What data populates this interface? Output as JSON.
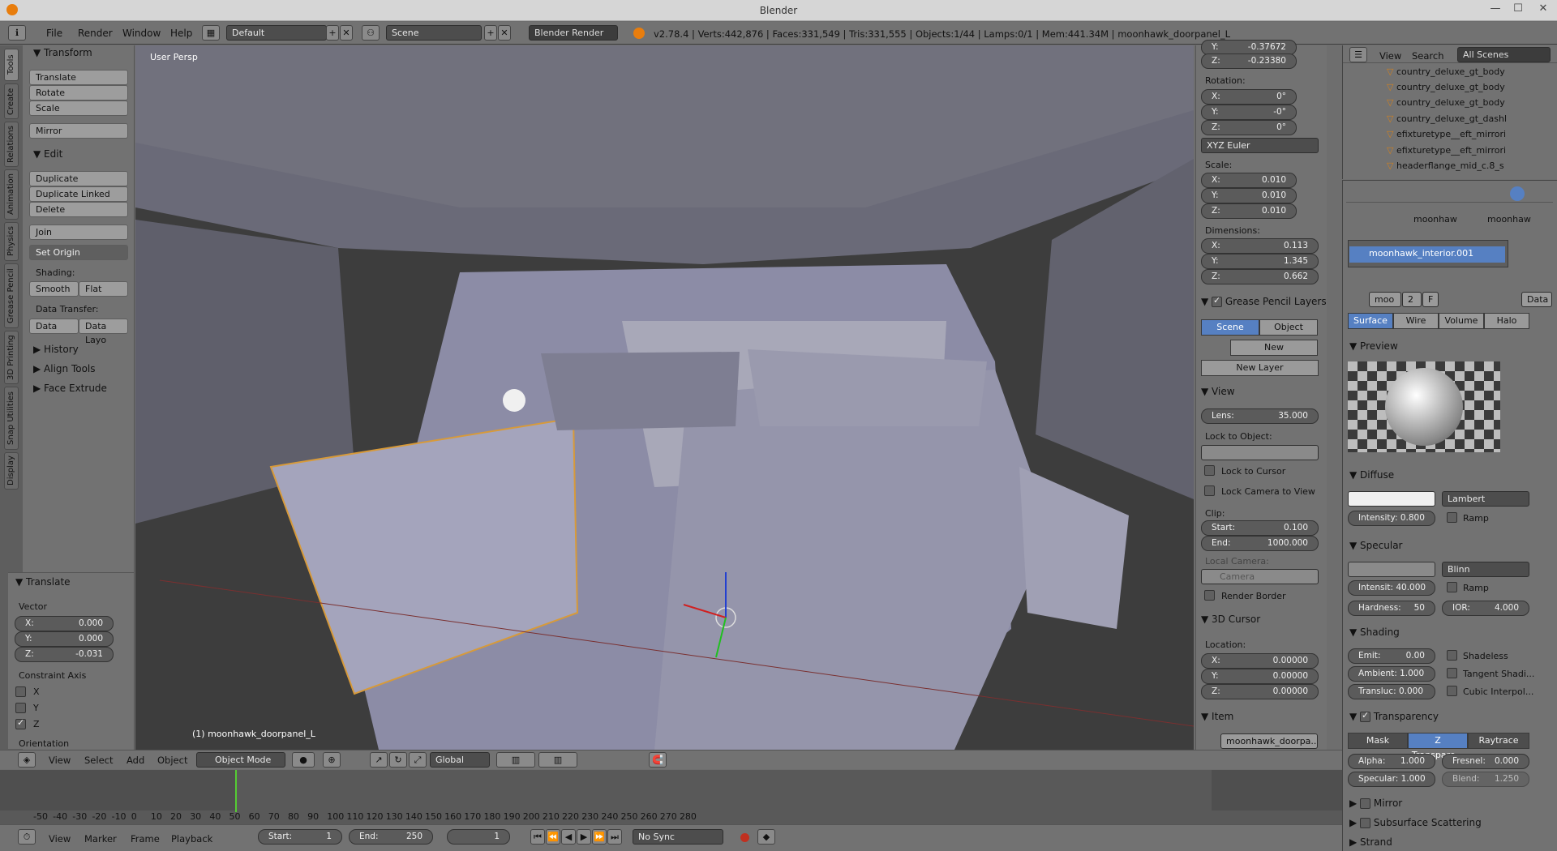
{
  "window": {
    "title": "Blender"
  },
  "topbar": {
    "menus": [
      "File",
      "Render",
      "Window",
      "Help"
    ],
    "screen_layout": "Default",
    "scene": "Scene",
    "render_engine": "Blender Render",
    "status": "v2.78.4 | Verts:442,876 | Faces:331,549 | Tris:331,555 | Objects:1/44 | Lamps:0/1 | Mem:441.34M | moonhawk_doorpanel_L"
  },
  "tool_tabs": [
    "Tools",
    "Create",
    "Relations",
    "Animation",
    "Physics",
    "Grease Pencil",
    "3D Printing",
    "Snap Utilities",
    "Display"
  ],
  "toolshelf": {
    "transform_header": "Transform",
    "transform_buttons": [
      "Translate",
      "Rotate",
      "Scale"
    ],
    "mirror": "Mirror",
    "edit_header": "Edit",
    "edit_buttons": [
      "Duplicate",
      "Duplicate Linked",
      "Delete"
    ],
    "join": "Join",
    "set_origin": "Set Origin",
    "shading_label": "Shading:",
    "smooth": "Smooth",
    "flat": "Flat",
    "data_transfer_label": "Data Transfer:",
    "data": "Data",
    "data_layo": "Data Layo",
    "collapsed": [
      "History",
      "Align Tools",
      "Face Extrude"
    ]
  },
  "operator": {
    "header": "Translate",
    "vector_label": "Vector",
    "x": "0.000",
    "y": "0.000",
    "z": "-0.031",
    "constraint_label": "Constraint Axis",
    "axes": [
      "X",
      "Y",
      "Z"
    ],
    "z_checked": true,
    "orientation": "Orientation"
  },
  "viewport": {
    "view_label": "User Persp",
    "object_label": "(1) moonhawk_doorpanel_L"
  },
  "npanel": {
    "loc_y": "-0.37672",
    "loc_z": "-0.23380",
    "rotation_label": "Rotation:",
    "rot_x": "0°",
    "rot_y": "-0°",
    "rot_z": "0°",
    "rot_mode": "XYZ Euler",
    "scale_label": "Scale:",
    "sc_x": "0.010",
    "sc_y": "0.010",
    "sc_z": "0.010",
    "dimensions_label": "Dimensions:",
    "dim_x": "0.113",
    "dim_y": "1.345",
    "dim_z": "0.662",
    "gp_header": "Grease Pencil Layers",
    "gp_scene": "Scene",
    "gp_object": "Object",
    "gp_new": "New",
    "gp_new_layer": "New Layer",
    "view_header": "View",
    "lens": "35.000",
    "lock_obj_label": "Lock to Object:",
    "lock_cursor": "Lock to Cursor",
    "lock_camera": "Lock Camera to View",
    "clip_label": "Clip:",
    "clip_start": "0.100",
    "clip_end": "1000.000",
    "local_camera_label": "Local Camera:",
    "camera": "Camera",
    "render_border": "Render Border",
    "cursor_header": "3D Cursor",
    "location_label": "Location:",
    "cur_x": "0.00000",
    "cur_y": "0.00000",
    "cur_z": "0.00000",
    "item_header": "Item",
    "item_name": "moonhawk_doorpa..."
  },
  "outliner": {
    "menus": [
      "View",
      "Search"
    ],
    "scope": "All Scenes",
    "items": [
      "country_deluxe_gt_body",
      "country_deluxe_gt_body",
      "country_deluxe_gt_body",
      "country_deluxe_gt_dashl",
      "efixturetype__eft_mirrori",
      "efixturetype__eft_mirrori",
      "headerflange_mid_c.8_s"
    ]
  },
  "properties": {
    "breadcrumb1": "moonhaw",
    "breadcrumb2": "moonhaw",
    "material_slot": "moonhawk_interior.001",
    "mat_short": "moo",
    "users": "2",
    "fake": "F",
    "data_dd": "Data",
    "tabs": [
      "Surface",
      "Wire",
      "Volume",
      "Halo"
    ],
    "preview_header": "Preview",
    "diffuse_header": "Diffuse",
    "diffuse_shader": "Lambert",
    "intensity": "Intensity: 0.800",
    "ramp": "Ramp",
    "specular_header": "Specular",
    "spec_shader": "Blinn",
    "spec_intensity": "Intensit: 40.000",
    "hardness": "Hardness:",
    "hardness_val": "50",
    "ior": "IOR:",
    "ior_val": "4.000",
    "shading_header": "Shading",
    "emit": "Emit:",
    "emit_val": "0.00",
    "shadeless": "Shadeless",
    "ambient": "Ambient: 1.000",
    "tangent": "Tangent Shadi...",
    "transluc": "Transluc: 0.000",
    "cubic": "Cubic Interpol...",
    "transparency_header": "Transparency",
    "mask": "Mask",
    "ztransp": "Z Transpare...",
    "raytrace": "Raytrace",
    "alpha": "Alpha:",
    "alpha_val": "1.000",
    "fresnel": "Fresnel:",
    "fresnel_val": "0.000",
    "specular_t": "Specular: 1.000",
    "blend": "Blend:",
    "blend_val": "1.250",
    "mirror": "Mirror",
    "sss": "Subsurface Scattering",
    "strand": "Strand"
  },
  "view3d_header": {
    "menus": [
      "View",
      "Select",
      "Add",
      "Object"
    ],
    "mode": "Object Mode",
    "orientation": "Global"
  },
  "timeline": {
    "ticks": [
      "-50",
      "-40",
      "-30",
      "-20",
      "-10",
      "0",
      "10",
      "20",
      "30",
      "40",
      "50",
      "60",
      "70",
      "80",
      "90",
      "100",
      "110",
      "120",
      "130",
      "140",
      "150",
      "160",
      "170",
      "180",
      "190",
      "200",
      "210",
      "220",
      "230",
      "240",
      "250",
      "260",
      "270",
      "280"
    ],
    "menus": [
      "View",
      "Marker",
      "Frame",
      "Playback"
    ],
    "start": "Start:",
    "start_val": "1",
    "end": "End:",
    "end_val": "250",
    "current": "1",
    "sync": "No Sync"
  }
}
